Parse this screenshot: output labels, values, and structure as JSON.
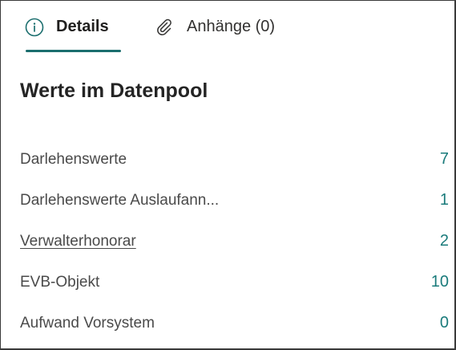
{
  "tabs": [
    {
      "label": "Details",
      "icon": "info-circle-icon",
      "selected": true
    },
    {
      "label": "Anhänge (0)",
      "icon": "paperclip-icon",
      "selected": false
    }
  ],
  "colors": {
    "accent": "#1b6e6e",
    "count": "#1a7b7b",
    "text": "#4a4a4a",
    "heading": "#242424"
  },
  "section": {
    "title": "Werte im Datenpool"
  },
  "rows": [
    {
      "label": "Darlehenswerte",
      "count": "7",
      "link": false
    },
    {
      "label": "Darlehenswerte Auslaufann...",
      "count": "1",
      "link": false
    },
    {
      "label": "Verwalterhonorar",
      "count": "2",
      "link": true
    },
    {
      "label": "EVB-Objekt",
      "count": "10",
      "link": false
    },
    {
      "label": "Aufwand Vorsystem",
      "count": "0",
      "link": false
    }
  ]
}
